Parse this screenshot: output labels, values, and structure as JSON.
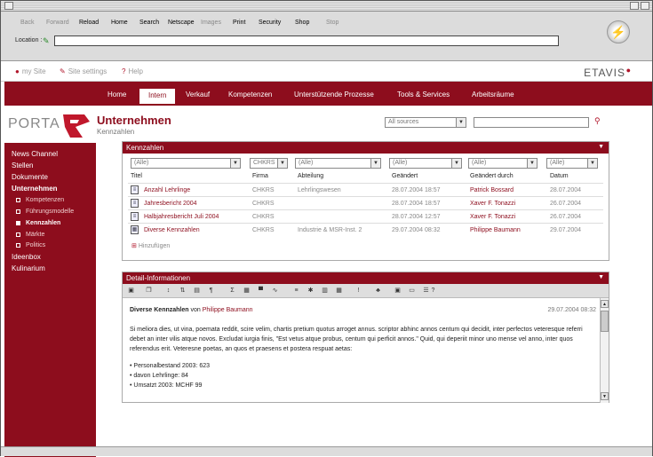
{
  "browser": {
    "buttons": [
      {
        "label": "Back",
        "enabled": false
      },
      {
        "label": "Forward",
        "enabled": false
      },
      {
        "label": "Reload",
        "enabled": true
      },
      {
        "label": "Home",
        "enabled": true
      },
      {
        "label": "Search",
        "enabled": true
      },
      {
        "label": "Netscape",
        "enabled": true
      },
      {
        "label": "Images",
        "enabled": false
      },
      {
        "label": "Print",
        "enabled": true
      },
      {
        "label": "Security",
        "enabled": true
      },
      {
        "label": "Shop",
        "enabled": true
      },
      {
        "label": "Stop",
        "enabled": false
      }
    ],
    "location_label": "Location :",
    "location_value": ""
  },
  "site_links": {
    "my_site": "my Site",
    "settings": "Site settings",
    "help": "Help"
  },
  "logo": "ETAVIS",
  "nav": [
    "Home",
    "Intern",
    "Verkauf",
    "Kompetenzen",
    "Unterstützende Prozesse",
    "Tools & Services",
    "Arbeitsräume"
  ],
  "nav_active": "Intern",
  "header": {
    "brand": "PORTA",
    "title": "Unternehmen",
    "subtitle": "Kennzahlen",
    "source_select": "All sources"
  },
  "sidebar": {
    "items": [
      "News Channel",
      "Stellen",
      "Dokumente",
      "Unternehmen"
    ],
    "sub": [
      "Kompetenzen",
      "Führungsmodelle",
      "Kennzahlen",
      "Märkte",
      "Politics"
    ],
    "active_sub": "Kennzahlen",
    "items2": [
      "Ideenbox",
      "Kulinarium"
    ]
  },
  "kennzahlen": {
    "title": "Kennzahlen",
    "filters": [
      "(Alle)",
      "CHKRS",
      "(Alle)",
      "(Alle)",
      "(Alle)",
      "(Alle)"
    ],
    "columns": [
      "Titel",
      "Firma",
      "Abteilung",
      "Geändert",
      "Geändert durch",
      "Datum"
    ],
    "rows": [
      {
        "titel": "Anzahl Lehrlinge",
        "firma": "CHKRS",
        "abteilung": "Lehrlingswesen",
        "geaendert": "28.07.2004  18:57",
        "durch": "Patrick Bossard",
        "datum": "28.07.2004"
      },
      {
        "titel": "Jahresbericht 2004",
        "firma": "CHKRS",
        "abteilung": "",
        "geaendert": "28.07.2004  18:57",
        "durch": "Xaver F. Tonazzi",
        "datum": "26.07.2004"
      },
      {
        "titel": "Halbjahresbericht Juli 2004",
        "firma": "CHKRS",
        "abteilung": "",
        "geaendert": "28.07.2004  12:57",
        "durch": "Xaver F. Tonazzi",
        "datum": "26.07.2004"
      },
      {
        "titel": "Diverse Kennzahlen",
        "firma": "CHKRS",
        "abteilung": "Industrie & MSR-Inst. 2",
        "geaendert": "29.07.2004  08:32",
        "durch": "Philippe Baumann",
        "datum": "29.07.2004"
      }
    ],
    "add": "Hinzufügen"
  },
  "detail": {
    "title": "Detail-Informationen",
    "doc_title": "Diverse Kennzahlen",
    "by": "von",
    "author": "Philippe Baumann",
    "date": "29.07.2004  08:32",
    "body": "Si meliora dies, ut vina, poemata reddit, scire velim, chartis pretium quotus arroget annus. scriptor abhinc annos centum qui decidit, inter perfectos veteresque referri debet an inter vilis atque novos. Excludat iurgia finis, \"Est vetus atque probus, centum qui perficit annos.\" Quid, qui deperiit minor uno mense vel anno, inter quos referendus erit. Veteresne poetas, an quos et praesens et postera respuat aetas:",
    "bullets": [
      "• Personalbestand 2003: 623",
      "• davon Lehrlinge: 84",
      "• Umsatzt 2003: MCHF 99"
    ]
  }
}
